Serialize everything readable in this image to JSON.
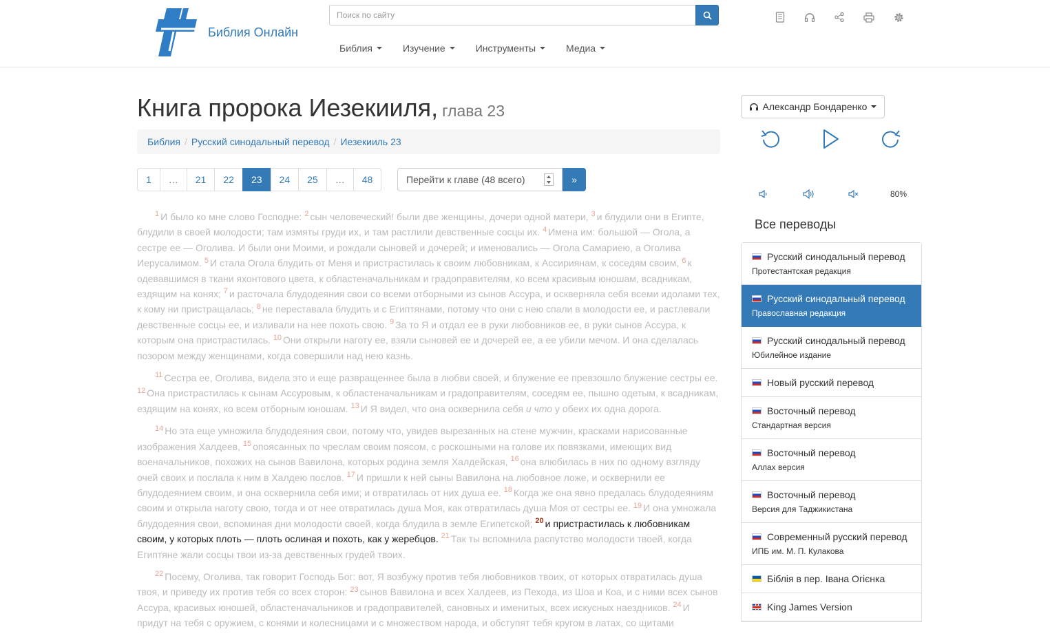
{
  "site": {
    "name": "Библия Онлайн"
  },
  "search": {
    "placeholder": "Поиск по сайту"
  },
  "nav": [
    {
      "label": "Библия"
    },
    {
      "label": "Изучение"
    },
    {
      "label": "Инструменты"
    },
    {
      "label": "Медиа"
    }
  ],
  "tools": [
    "book-icon",
    "headphones-icon",
    "share-icon",
    "print-icon",
    "gear-icon"
  ],
  "page": {
    "title": "Книга пророка Иезекииля,",
    "subtitle": "глава 23"
  },
  "breadcrumb": [
    "Библия",
    "Русский синодальный перевод",
    "Иезекииль 23"
  ],
  "pagination": [
    "1",
    "…",
    "21",
    "22",
    "23",
    "24",
    "25",
    "…",
    "48"
  ],
  "pagination_active": "23",
  "goto": {
    "placeholder": "Перейти к главе (48 всего)",
    "button": "»"
  },
  "text": {
    "p1": [
      {
        "n": "1",
        "t": "И было ко мне слово Господне: "
      },
      {
        "n": "2",
        "t": "сын человеческий! были две женщины, дочери одной матери, "
      },
      {
        "n": "3",
        "t": "и блудили они в Египте, блудили в своей молодости; там измяты груди их, и там растлили девственные сосцы их. "
      },
      {
        "n": "4",
        "t": "Имена им: большой — Огола, а сестре ее — Оголива. И были они Моими, и рождали сыновей и дочерей; и именовались — Огола Самариею, а Оголива Иерусалимом. "
      },
      {
        "n": "5",
        "t": "И стала Огола блудить от Меня и пристрастилась к своим любовникам, к Ассириянам, к соседям своим, "
      },
      {
        "n": "6",
        "t": "к одевавшимся в ткани яхонтового цвета, к областеначальникам и градоправителям, ко всем красивым юношам, всадникам, ездящим на конях; "
      },
      {
        "n": "7",
        "t": "и расточала блудодеяния свои со всеми отборными из сынов Ассура, и оскверняла себя всеми идолами тех, к кому ни пристращалась; "
      },
      {
        "n": "8",
        "t": "не переставала блудить и с Египтянами, потому что они с нею спали в молодости ее, и растлевали девственные сосцы ее, и изливали на нее похоть свою. "
      },
      {
        "n": "9",
        "t": "За то Я и отдал ее в руки любовников ее, в руки сынов Ассура, к которым она пристрастилась. "
      },
      {
        "n": "10",
        "t": "Они открыли наготу ее, взяли сыновей ее и дочерей ее, а ее убили мечом. И она сделалась позором между женщинами, когда совершили над нею казнь."
      }
    ],
    "p2": [
      {
        "n": "11",
        "t": "Сестра ее, Оголива, видела это и еще развращеннее была в любви своей, и блужение ее превзошло блужение сестры ее. "
      },
      {
        "n": "12",
        "t": "Она пристрастилась к сынам Ассуровым, к областеначальникам и градоправителям, соседям ее, пышно одетым, к всадникам, ездящим на конях, ко всем отборным юношам. "
      },
      {
        "n": "13",
        "t": "И Я видел, что она осквернила себя ",
        "i": "и что",
        "t2": " у обеих их одна дорога."
      }
    ],
    "p3": [
      {
        "n": "14",
        "t": "Но эта еще умножила блудодеяния свои, потому что, увидев вырезанных на стене мужчин, красками нарисованные изображения Халдеев, "
      },
      {
        "n": "15",
        "t": "опоясанных по чреслам своим поясом, с роскошными на голове их повязками, имеющих вид военачальников, похожих на сынов Вавилона, которых родина земля Халдейская, "
      },
      {
        "n": "16",
        "t": "она влюбилась в них по одному взгляду очей своих и послала к ним в Халдею послов. "
      },
      {
        "n": "17",
        "t": "И пришли к ней сыны Вавилона на любовное ложе, и осквернили ее блудодеянием своим, и она осквернила себя ими; и отвратилась от них душа ее. "
      },
      {
        "n": "18",
        "t": "Когда же она явно предалась блудодеяниям своим и открыла наготу свою, тогда и от нее отвратилась душа Моя, как отвратилась душа Моя от сестры ее. "
      },
      {
        "n": "19",
        "t": "И она умножала блудодеяния свои, вспоминая дни молодости своей, когда блудила в земле Египетской; "
      },
      {
        "n": "20",
        "t": "и пристрастилась к любовникам своим, у которых плоть — плоть ослиная и похоть, как у жеребцов. ",
        "hl": true
      },
      {
        "n": "21",
        "t": "Так ты вспомнила распутство молодости твоей, когда Египтяне жали сосцы твои из-за девственных грудей твоих."
      }
    ],
    "p4": [
      {
        "n": "22",
        "t": "Посему, Оголива, так говорит Господь Бог: вот, Я возбужу против тебя любовников твоих, от которых отвратилась душа твоя, и приведу их против тебя со всех сторон: "
      },
      {
        "n": "23",
        "t": "сынов Вавилона и всех Халдеев, из Пехода, из Шоа и Коа, и с ними всех сынов Ассура, красивых юношей, областеначальников и градоправителей, сановных и именитых, всех искусных наездников. "
      },
      {
        "n": "24",
        "t": "И придут на тебя с оружием, с конями и колесницами и с множеством народа, и обступят тебя кругом в латах, со щитами"
      }
    ]
  },
  "audio": {
    "reader": "Александр Бондаренко",
    "volume": "80%"
  },
  "translations_heading": "Все переводы",
  "translations": [
    {
      "title": "Русский синодальный перевод",
      "sub": "Протестантская редакция",
      "flag": "ru"
    },
    {
      "title": "Русский синодальный перевод",
      "sub": "Православная редакция",
      "flag": "ru",
      "active": true
    },
    {
      "title": "Русский синодальный перевод",
      "sub": "Юбилейное издание",
      "flag": "ru"
    },
    {
      "title": "Новый русский перевод",
      "sub": "",
      "flag": "ru"
    },
    {
      "title": "Восточный перевод",
      "sub": "Стандартная версия",
      "flag": "ru"
    },
    {
      "title": "Восточный перевод",
      "sub": "Аллах версия",
      "flag": "ru"
    },
    {
      "title": "Восточный перевод",
      "sub": "Версия для Таджикистана",
      "flag": "ru"
    },
    {
      "title": "Современный русский перевод",
      "sub": "ИПБ им. М. П. Кулакова",
      "flag": "ru"
    },
    {
      "title": "Біблія в пер. Івана Огієнка",
      "sub": "",
      "flag": "ua"
    },
    {
      "title": "King James Version",
      "sub": "",
      "flag": "gb"
    }
  ],
  "colors": {
    "accent": "#337ab7",
    "verse_number": "#e8a594",
    "highlight_verse_number": "#9a3412"
  }
}
